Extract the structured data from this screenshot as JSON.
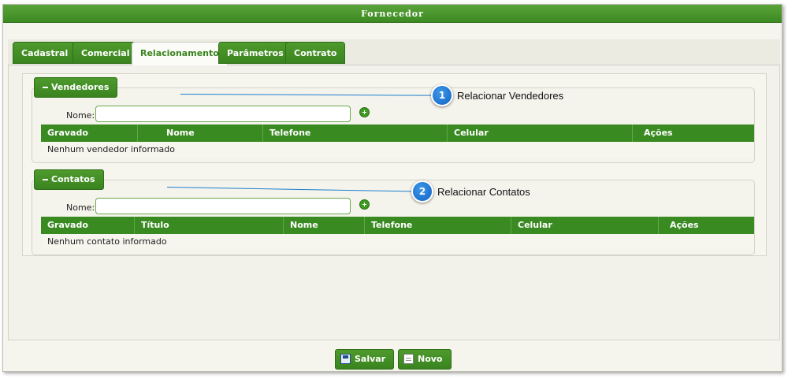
{
  "window": {
    "title": "Fornecedor"
  },
  "tabs": [
    {
      "label": "Cadastral"
    },
    {
      "label": "Comercial"
    },
    {
      "label": "Relacionamento"
    },
    {
      "label": "Parâmetros"
    },
    {
      "label": "Contrato"
    }
  ],
  "active_tab": "Relacionamento",
  "vendedores": {
    "legend": "Vendedores",
    "name_label": "Nome:",
    "name_value": "",
    "columns": [
      "Gravado",
      "Nome",
      "Telefone",
      "Celular",
      "Ações"
    ],
    "empty_text": "Nenhum vendedor informado"
  },
  "contatos": {
    "legend": "Contatos",
    "name_label": "Nome:",
    "name_value": "",
    "columns": [
      "Gravado",
      "Título",
      "Nome",
      "Telefone",
      "Celular",
      "Ações"
    ],
    "empty_text": "Nenhum contato informado"
  },
  "callouts": [
    {
      "number": "1",
      "text": "Relacionar Vendedores"
    },
    {
      "number": "2",
      "text": "Relacionar Contatos"
    }
  ],
  "footer": {
    "save_label": "Salvar",
    "new_label": "Novo"
  },
  "colors": {
    "accent": "#3a8a22",
    "callout": "#1f7fce"
  },
  "icons": {
    "legend": "minus-icon",
    "add": "plus-circle-icon",
    "save": "floppy-disk-icon",
    "new": "document-icon"
  }
}
